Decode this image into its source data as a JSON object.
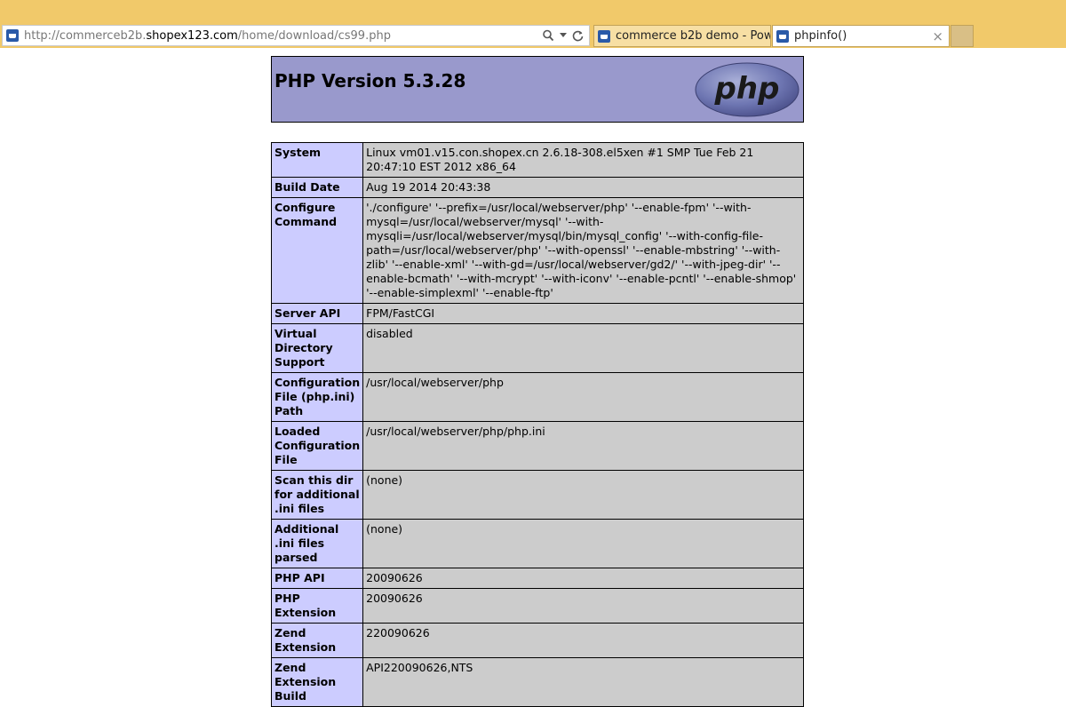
{
  "browser": {
    "url_prefix": "http://commerceb2b.",
    "url_domain": "shopex123.com",
    "url_path": "/home/download/cs99.php",
    "tabs": [
      {
        "label": "commerce b2b demo - Pow..."
      },
      {
        "label": "phpinfo()"
      }
    ],
    "tab_close": "×"
  },
  "header": {
    "title": "PHP Version 5.3.28",
    "logo_text": "php"
  },
  "rows": [
    {
      "key": "System",
      "value": "Linux vm01.v15.con.shopex.cn 2.6.18-308.el5xen #1 SMP Tue Feb 21 20:47:10 EST 2012 x86_64"
    },
    {
      "key": "Build Date",
      "value": "Aug 19 2014 20:43:38"
    },
    {
      "key": "Configure Command",
      "value": "'./configure' '--prefix=/usr/local/webserver/php' '--enable-fpm' '--with-mysql=/usr/local/webserver/mysql' '--with-mysqli=/usr/local/webserver/mysql/bin/mysql_config' '--with-config-file-path=/usr/local/webserver/php' '--with-openssl' '--enable-mbstring' '--with-zlib' '--enable-xml' '--with-gd=/usr/local/webserver/gd2/' '--with-jpeg-dir' '--enable-bcmath' '--with-mcrypt' '--with-iconv' '--enable-pcntl' '--enable-shmop' '--enable-simplexml' '--enable-ftp'"
    },
    {
      "key": "Server API",
      "value": "FPM/FastCGI"
    },
    {
      "key": "Virtual Directory Support",
      "value": "disabled"
    },
    {
      "key": "Configuration File (php.ini) Path",
      "value": "/usr/local/webserver/php"
    },
    {
      "key": "Loaded Configuration File",
      "value": "/usr/local/webserver/php/php.ini"
    },
    {
      "key": "Scan this dir for additional .ini files",
      "value": "(none)"
    },
    {
      "key": "Additional .ini files parsed",
      "value": "(none)"
    },
    {
      "key": "PHP API",
      "value": "20090626"
    },
    {
      "key": "PHP Extension",
      "value": "20090626"
    },
    {
      "key": "Zend Extension",
      "value": "220090626"
    },
    {
      "key": "Zend Extension Build",
      "value": "API220090626,NTS"
    }
  ]
}
